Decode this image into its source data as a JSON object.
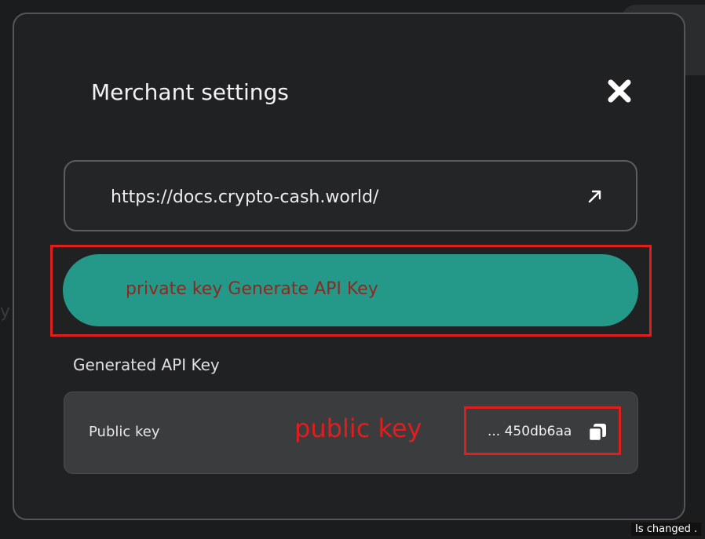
{
  "modal": {
    "title": "Merchant settings",
    "close_icon": "close-icon"
  },
  "docs_link": {
    "url": "https://docs.crypto-cash.world/",
    "icon": "external-link-arrow-icon"
  },
  "generate_button": {
    "label": "private key Generate API Key",
    "color": "#24998a"
  },
  "generated_section": {
    "title": "Generated API Key",
    "public_key_label": "Public key",
    "public_key_value": "... 450db6aa",
    "copy_icon": "copy-icon"
  },
  "annotations": {
    "public_key_note": "public key",
    "highlight_color": "#e01e1e"
  },
  "toast": {
    "text": "Is changed ."
  }
}
